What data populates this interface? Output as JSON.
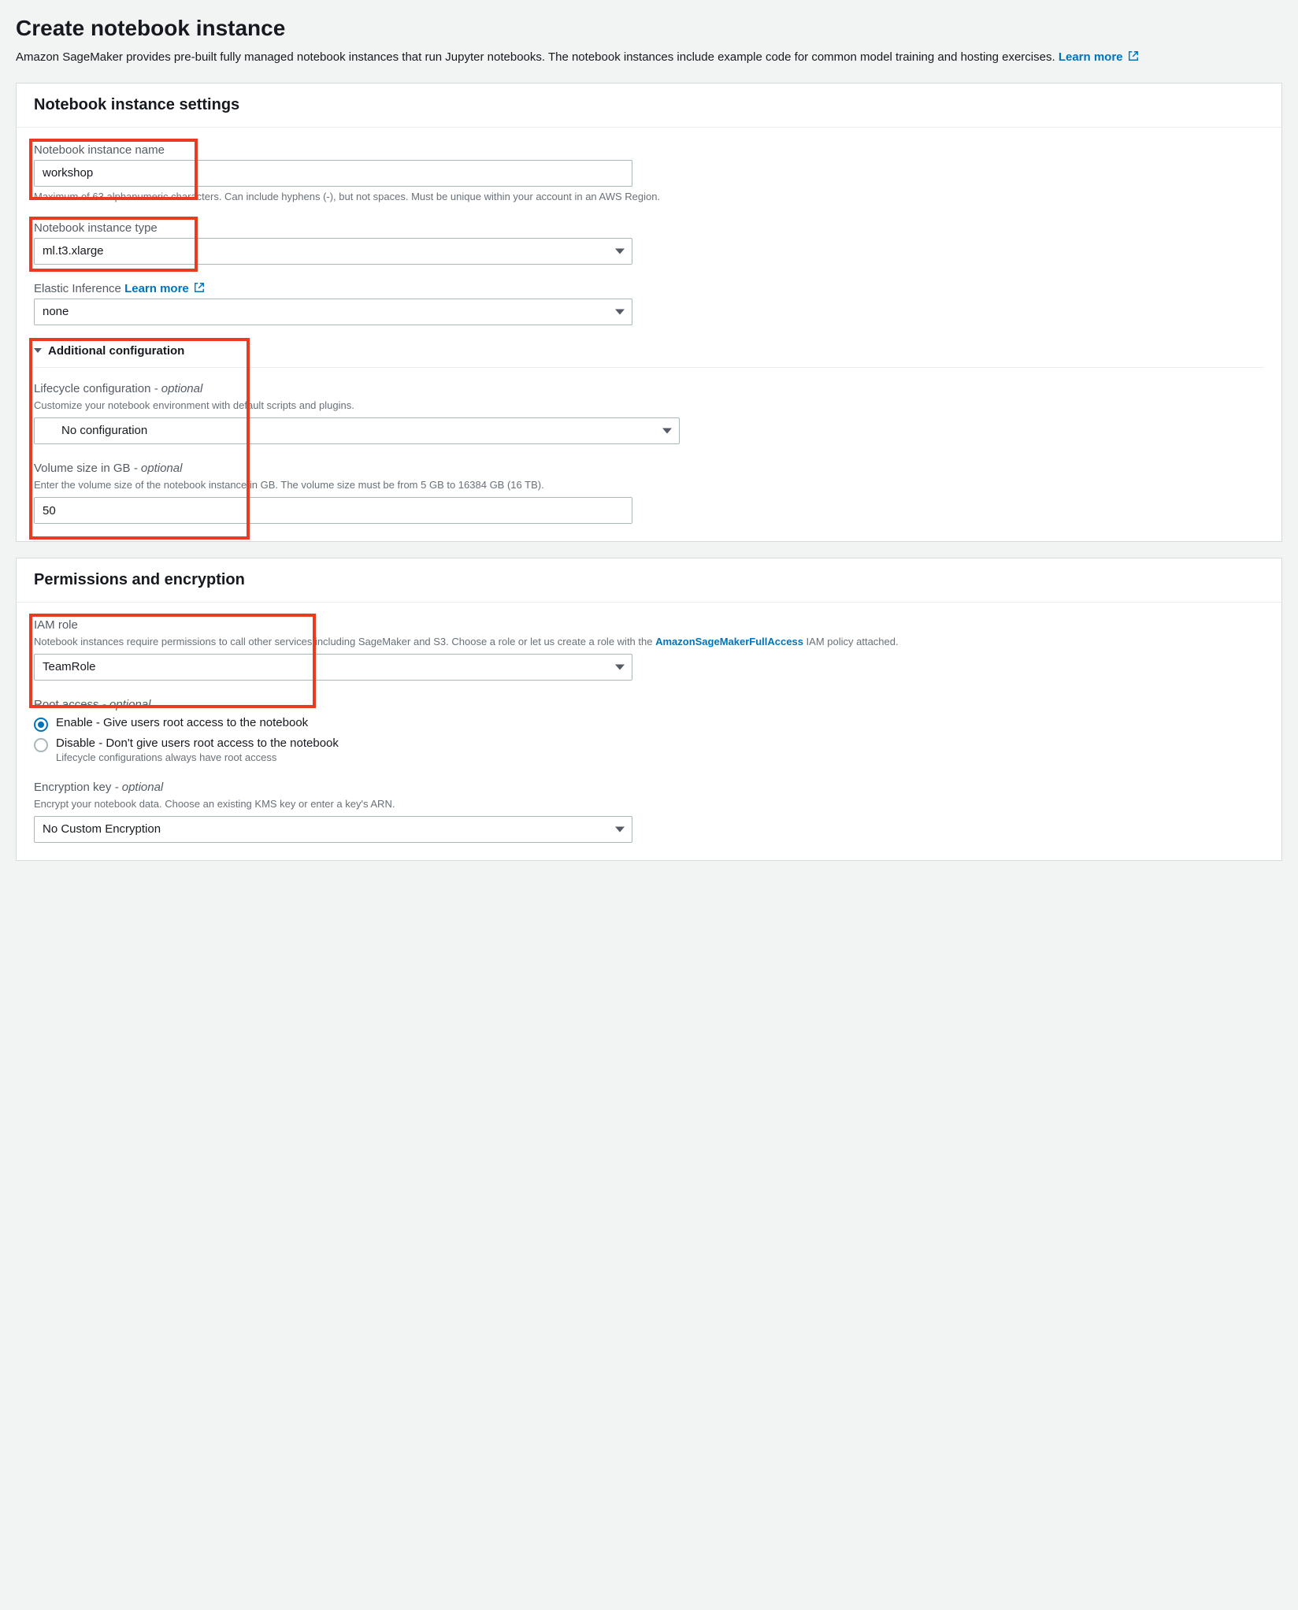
{
  "page": {
    "title": "Create notebook instance",
    "description_prefix": "Amazon SageMaker provides pre-built fully managed notebook instances that run Jupyter notebooks. The notebook instances include example code for common model training and hosting exercises. ",
    "learn_more": "Learn more"
  },
  "settings_panel": {
    "title": "Notebook instance settings",
    "name": {
      "label": "Notebook instance name",
      "value": "workshop",
      "help": "Maximum of 63 alphanumeric characters. Can include hyphens (-), but not spaces. Must be unique within your account in an AWS Region."
    },
    "type": {
      "label": "Notebook instance type",
      "value": "ml.t3.xlarge"
    },
    "elastic_inference": {
      "label": "Elastic Inference",
      "learn_more": "Learn more",
      "value": "none"
    },
    "additional": {
      "title": "Additional configuration",
      "lifecycle": {
        "label": "Lifecycle configuration",
        "optional": "- optional",
        "help": "Customize your notebook environment with default scripts and plugins.",
        "value": "No configuration"
      },
      "volume": {
        "label": "Volume size in GB",
        "optional": "- optional",
        "help": "Enter the volume size of the notebook instance in GB. The volume size must be from 5 GB to 16384 GB (16 TB).",
        "value": "50"
      }
    }
  },
  "permissions_panel": {
    "title": "Permissions and encryption",
    "iam": {
      "label": "IAM role",
      "help_prefix": "Notebook instances require permissions to call other services including SageMaker and S3. Choose a role or let us create a role with the ",
      "policy_link": "AmazonSageMakerFullAccess",
      "help_suffix": " IAM policy attached.",
      "value": "TeamRole"
    },
    "root": {
      "label": "Root access",
      "optional": "- optional",
      "enable": "Enable - Give users root access to the notebook",
      "disable": "Disable - Don't give users root access to the notebook",
      "disable_sub": "Lifecycle configurations always have root access",
      "selected": "enable"
    },
    "encryption": {
      "label": "Encryption key",
      "optional": "- optional",
      "help": "Encrypt your notebook data. Choose an existing KMS key or enter a key's ARN.",
      "value": "No Custom Encryption"
    }
  }
}
